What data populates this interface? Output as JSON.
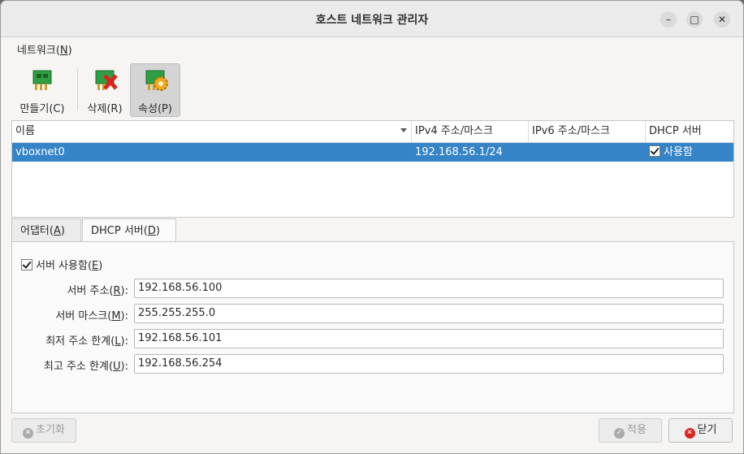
{
  "window": {
    "title": "호스트 네트워크 관리자"
  },
  "menubar": {
    "network_label": "네트워크",
    "network_mnemonic": "N"
  },
  "toolbar": {
    "create_label": "만들기(C)",
    "delete_label": "삭제(R)",
    "properties_label": "속성(P)"
  },
  "table": {
    "columns": [
      "이름",
      "IPv4 주소/마스크",
      "IPv6 주소/마스크",
      "DHCP 서버"
    ],
    "rows": [
      {
        "name": "vboxnet0",
        "ipv4": "192.168.56.1/24",
        "ipv6": "",
        "dhcp": "사용함",
        "dhcp_checked": true
      }
    ]
  },
  "tabs": [
    {
      "label": "어댑터",
      "mnemonic": "A",
      "selected": false
    },
    {
      "label": "DHCP 서버",
      "mnemonic": "D",
      "selected": true
    }
  ],
  "dhcp": {
    "enable_label": "서버 사용함",
    "enable_mnemonic": "E",
    "enabled": true,
    "fields": [
      {
        "label": "서버 주소",
        "mnemonic": "R",
        "value": "192.168.56.100"
      },
      {
        "label": "서버 마스크",
        "mnemonic": "M",
        "value": "255.255.255.0"
      },
      {
        "label": "최저 주소 한계",
        "mnemonic": "L",
        "value": "192.168.56.101"
      },
      {
        "label": "최고 주소 한계",
        "mnemonic": "U",
        "value": "192.168.56.254"
      }
    ]
  },
  "buttons": {
    "reset": "초기화",
    "apply": "적용",
    "close": "닫기"
  },
  "colors": {
    "selection": "#3584c8",
    "close_icon": "#d9251d"
  }
}
